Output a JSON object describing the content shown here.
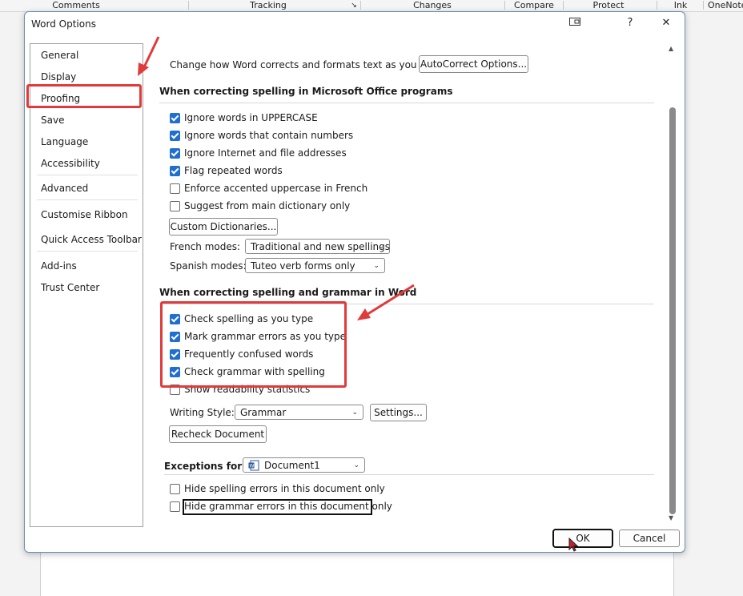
{
  "ribbon": {
    "groups": [
      "Comments",
      "Tracking",
      "Changes",
      "Compare",
      "Protect",
      "Ink",
      "OneNote"
    ]
  },
  "dialog": {
    "title": "Word Options",
    "help_label": "?",
    "close_label": "✕"
  },
  "nav": {
    "items": [
      "General",
      "Display",
      "Proofing",
      "Save",
      "Language",
      "Accessibility",
      "Advanced",
      "Customise Ribbon",
      "Quick Access Toolbar",
      "Add-ins",
      "Trust Center"
    ],
    "selected": "Proofing"
  },
  "autocorrect": {
    "label": "Change how Word corrects and formats text as you type:",
    "button": "AutoCorrect Options..."
  },
  "office_section": {
    "title": "When correcting spelling in Microsoft Office programs",
    "options": [
      {
        "label": "Ignore words in UPPERCASE",
        "checked": true
      },
      {
        "label": "Ignore words that contain numbers",
        "checked": true
      },
      {
        "label": "Ignore Internet and file addresses",
        "checked": true
      },
      {
        "label": "Flag repeated words",
        "checked": true
      },
      {
        "label": "Enforce accented uppercase in French",
        "checked": false
      },
      {
        "label": "Suggest from main dictionary only",
        "checked": false
      }
    ],
    "custom_dict_button": "Custom Dictionaries...",
    "french_label": "French modes:",
    "french_value": "Traditional and new spellings",
    "spanish_label": "Spanish modes:",
    "spanish_value": "Tuteo verb forms only"
  },
  "word_section": {
    "title": "When correcting spelling and grammar in Word",
    "options": [
      {
        "label": "Check spelling as you type",
        "checked": true
      },
      {
        "label": "Mark grammar errors as you type",
        "checked": true
      },
      {
        "label": "Frequently confused words",
        "checked": true
      },
      {
        "label": "Check grammar with spelling",
        "checked": true
      },
      {
        "label": "Show readability statistics",
        "checked": false
      }
    ],
    "writing_style_label": "Writing Style:",
    "writing_style_value": "Grammar",
    "settings_button": "Settings...",
    "recheck_button": "Recheck Document"
  },
  "exceptions": {
    "label": "Exceptions for:",
    "document": "Document1",
    "options": [
      {
        "label": "Hide spelling errors in this document only",
        "checked": false
      },
      {
        "label": "Hide grammar errors in this document only",
        "checked": false
      }
    ]
  },
  "footer": {
    "ok": "OK",
    "cancel": "Cancel"
  },
  "colors": {
    "accent": "#1f6fd0",
    "annotation": "#e03b3b"
  }
}
